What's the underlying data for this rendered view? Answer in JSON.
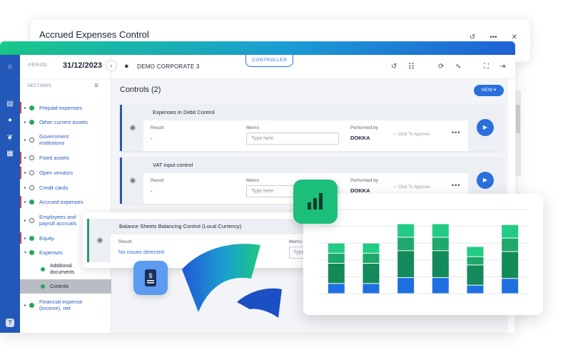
{
  "back_window": {
    "title": "Accrued Expenses Control",
    "controls": [
      "history-icon",
      "more-icon",
      "close-icon"
    ]
  },
  "sidebar": {
    "period_label": "PERIOD",
    "period_value": "31/12/2023",
    "sections_label": "SECTIONS",
    "items": [
      {
        "label": "Prepaid expenses",
        "status": "ok",
        "flag": true
      },
      {
        "label": "Other current assets",
        "status": "ok",
        "flag": false
      },
      {
        "label": "Government institutions",
        "status": "open",
        "flag": false
      },
      {
        "label": "Fixed assets",
        "status": "open",
        "flag": true
      },
      {
        "label": "Open vendors",
        "status": "open",
        "flag": true
      },
      {
        "label": "Credit cards",
        "status": "open",
        "flag": false
      },
      {
        "label": "Accrued expenses",
        "status": "ok",
        "flag": true
      },
      {
        "label": "Employees and payroll accruals",
        "status": "open",
        "flag": false
      },
      {
        "label": "Equity",
        "status": "ok",
        "flag": true
      },
      {
        "label": "Expenses",
        "status": "ok",
        "flag": false
      },
      {
        "label": "Financial expense (income), net",
        "status": "ok",
        "flag": false
      }
    ],
    "sub_items": [
      {
        "label": "Additional documents"
      },
      {
        "label": "Controls"
      }
    ]
  },
  "topbar": {
    "company": "DEMO CORPORATE 3",
    "role_badge": "CONTROLLER"
  },
  "main": {
    "title": "Controls (2)",
    "new_button": "NEW",
    "cards": [
      {
        "title": "Expenses in Debit Control",
        "result_label": "Result",
        "result_value": "-",
        "memo_label": "Memo",
        "memo_placeholder": "Type here",
        "performed_label": "Performed by",
        "performed_value": "DOKKA",
        "approve_label": "Click To Approve"
      },
      {
        "title": "VAT input control",
        "result_label": "Result",
        "result_value": "-",
        "memo_label": "Memo",
        "memo_placeholder": "Type here",
        "performed_label": "Performed by",
        "performed_value": "DOKKA",
        "approve_label": "Click To Approve"
      }
    ]
  },
  "overlay_card": {
    "title": "Balance Sheets Balancing Control (Local Currency)",
    "result_label": "Result",
    "result_value": "No issues detected",
    "memo_label": "Memo",
    "memo_placeholder": "Type"
  },
  "chart_data": {
    "type": "bar",
    "stacked": true,
    "series": [
      {
        "values": [
          1.2,
          1.2,
          1.9,
          1.9,
          1.0,
          1.8
        ]
      },
      {
        "values": [
          2.4,
          2.4,
          3.2,
          3.2,
          2.4,
          3.2
        ]
      },
      {
        "values": [
          1.2,
          1.2,
          1.6,
          1.6,
          1.0,
          1.6
        ]
      },
      {
        "values": [
          1.2,
          1.2,
          1.6,
          1.6,
          1.2,
          1.6
        ]
      }
    ],
    "colors": [
      "#1f6fe0",
      "#138a5a",
      "#1fa86c",
      "#22cc85"
    ],
    "ylim": [
      0,
      10
    ],
    "grid": true
  }
}
